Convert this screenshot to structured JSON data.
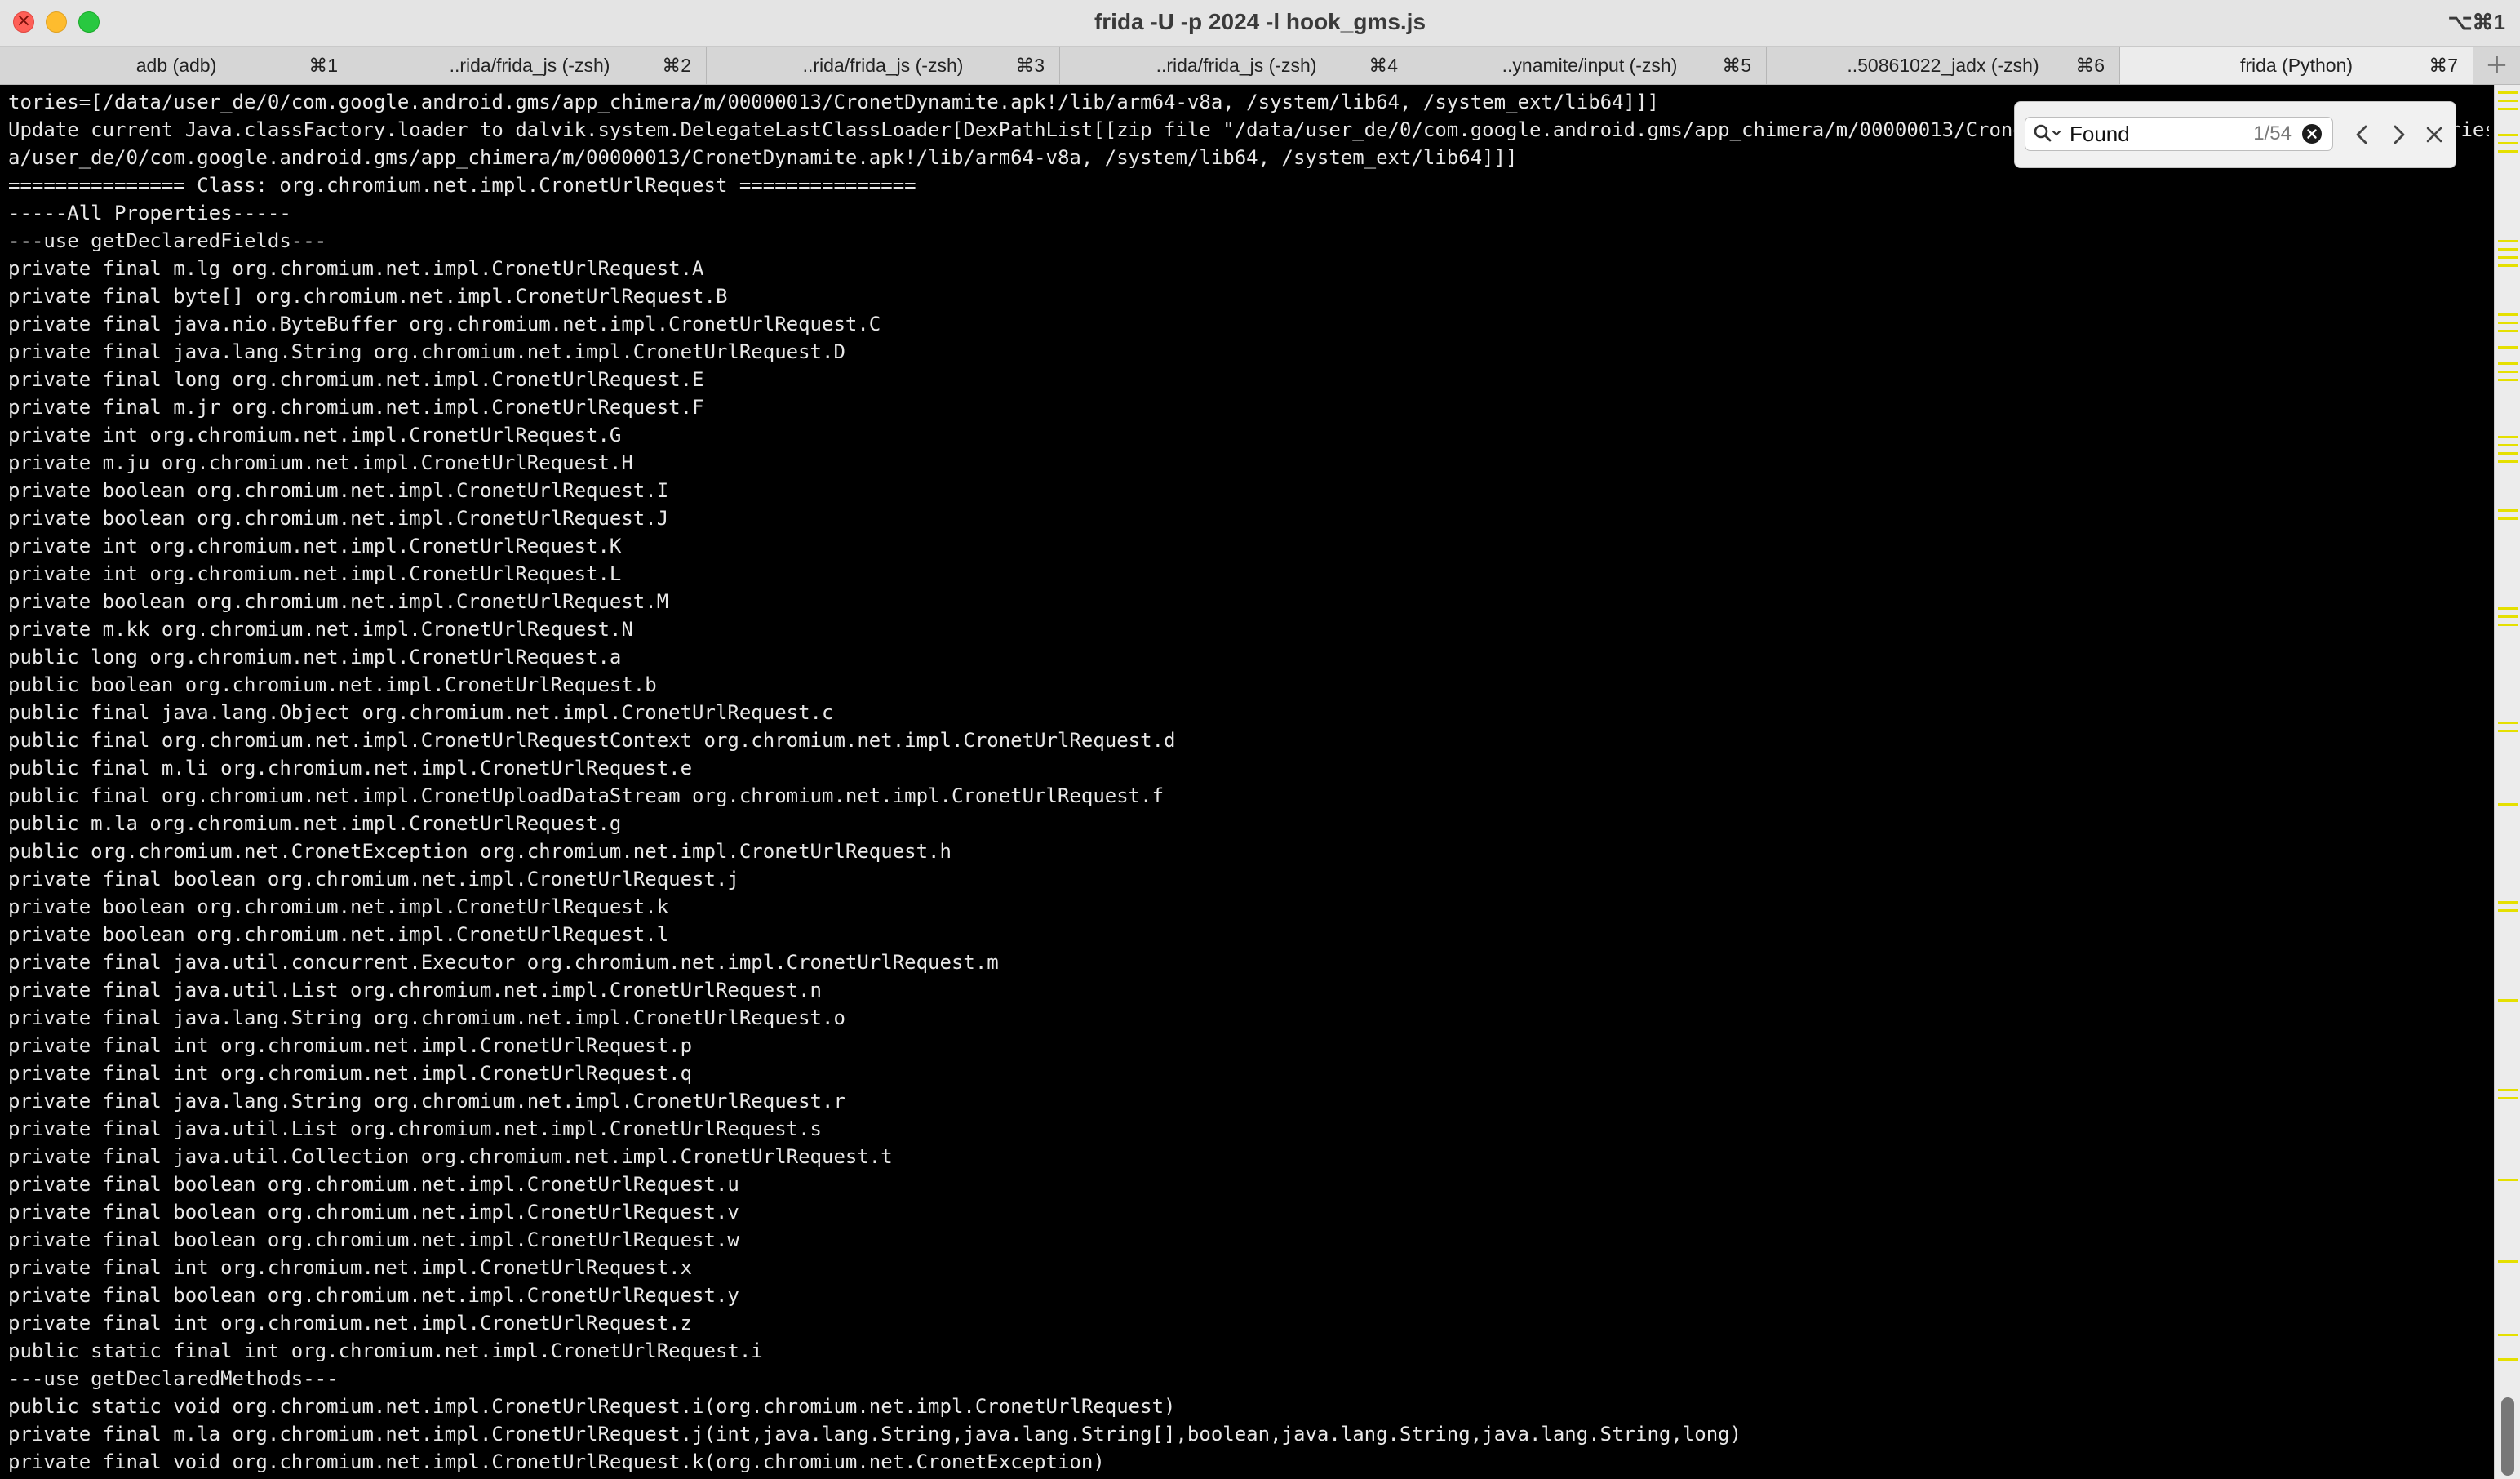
{
  "window": {
    "title": "frida -U -p 2024 -l hook_gms.js",
    "shortcut": "⌥⌘1"
  },
  "tabs": [
    {
      "label": "adb (adb)",
      "shortcut": "⌘1",
      "active": false
    },
    {
      "label": "..rida/frida_js (-zsh)",
      "shortcut": "⌘2",
      "active": false
    },
    {
      "label": "..rida/frida_js (-zsh)",
      "shortcut": "⌘3",
      "active": false
    },
    {
      "label": "..rida/frida_js (-zsh)",
      "shortcut": "⌘4",
      "active": false
    },
    {
      "label": "..ynamite/input (-zsh)",
      "shortcut": "⌘5",
      "active": false
    },
    {
      "label": "..50861022_jadx (-zsh)",
      "shortcut": "⌘6",
      "active": false
    },
    {
      "label": "frida (Python)",
      "shortcut": "⌘7",
      "active": true
    }
  ],
  "tab_add_label": "+",
  "find": {
    "query": "Found",
    "count": "1/54"
  },
  "icons": {
    "close": "close-icon",
    "search": "search-icon",
    "clear": "clear-icon",
    "prev": "chevron-left-icon",
    "next": "chevron-right-icon",
    "dismiss": "close-icon"
  },
  "colors": {
    "terminal_bg": "#000000",
    "terminal_fg": "#e8e8e8",
    "match_marker": "#e5e000"
  },
  "terminal": {
    "lines": [
      "tories=[/data/user_de/0/com.google.android.gms/app_chimera/m/00000013/CronetDynamite.apk!/lib/arm64-v8a, /system/lib64, /system_ext/lib64]]]",
      "Update current Java.classFactory.loader to dalvik.system.DelegateLastClassLoader[DexPathList[[zip file \"/data/user_de/0/com.google.android.gms/app_chimera/m/00000013/CronetDynamite.apk\"],nativeLibraryDirectories=[/dat",
      "a/user_de/0/com.google.android.gms/app_chimera/m/00000013/CronetDynamite.apk!/lib/arm64-v8a, /system/lib64, /system_ext/lib64]]]",
      "=============== Class: org.chromium.net.impl.CronetUrlRequest ===============",
      "-----All Properties-----",
      "---use getDeclaredFields---",
      "private final m.lg org.chromium.net.impl.CronetUrlRequest.A",
      "private final byte[] org.chromium.net.impl.CronetUrlRequest.B",
      "private final java.nio.ByteBuffer org.chromium.net.impl.CronetUrlRequest.C",
      "private final java.lang.String org.chromium.net.impl.CronetUrlRequest.D",
      "private final long org.chromium.net.impl.CronetUrlRequest.E",
      "private final m.jr org.chromium.net.impl.CronetUrlRequest.F",
      "private int org.chromium.net.impl.CronetUrlRequest.G",
      "private m.ju org.chromium.net.impl.CronetUrlRequest.H",
      "private boolean org.chromium.net.impl.CronetUrlRequest.I",
      "private boolean org.chromium.net.impl.CronetUrlRequest.J",
      "private int org.chromium.net.impl.CronetUrlRequest.K",
      "private int org.chromium.net.impl.CronetUrlRequest.L",
      "private boolean org.chromium.net.impl.CronetUrlRequest.M",
      "private m.kk org.chromium.net.impl.CronetUrlRequest.N",
      "public long org.chromium.net.impl.CronetUrlRequest.a",
      "public boolean org.chromium.net.impl.CronetUrlRequest.b",
      "public final java.lang.Object org.chromium.net.impl.CronetUrlRequest.c",
      "public final org.chromium.net.impl.CronetUrlRequestContext org.chromium.net.impl.CronetUrlRequest.d",
      "public final m.li org.chromium.net.impl.CronetUrlRequest.e",
      "public final org.chromium.net.impl.CronetUploadDataStream org.chromium.net.impl.CronetUrlRequest.f",
      "public m.la org.chromium.net.impl.CronetUrlRequest.g",
      "public org.chromium.net.CronetException org.chromium.net.impl.CronetUrlRequest.h",
      "private final boolean org.chromium.net.impl.CronetUrlRequest.j",
      "private boolean org.chromium.net.impl.CronetUrlRequest.k",
      "private boolean org.chromium.net.impl.CronetUrlRequest.l",
      "private final java.util.concurrent.Executor org.chromium.net.impl.CronetUrlRequest.m",
      "private final java.util.List org.chromium.net.impl.CronetUrlRequest.n",
      "private final java.lang.String org.chromium.net.impl.CronetUrlRequest.o",
      "private final int org.chromium.net.impl.CronetUrlRequest.p",
      "private final int org.chromium.net.impl.CronetUrlRequest.q",
      "private final java.lang.String org.chromium.net.impl.CronetUrlRequest.r",
      "private final java.util.List org.chromium.net.impl.CronetUrlRequest.s",
      "private final java.util.Collection org.chromium.net.impl.CronetUrlRequest.t",
      "private final boolean org.chromium.net.impl.CronetUrlRequest.u",
      "private final boolean org.chromium.net.impl.CronetUrlRequest.v",
      "private final boolean org.chromium.net.impl.CronetUrlRequest.w",
      "private final int org.chromium.net.impl.CronetUrlRequest.x",
      "private final boolean org.chromium.net.impl.CronetUrlRequest.y",
      "private final int org.chromium.net.impl.CronetUrlRequest.z",
      "public static final int org.chromium.net.impl.CronetUrlRequest.i",
      "---use getDeclaredMethods---",
      "public static void org.chromium.net.impl.CronetUrlRequest.i(org.chromium.net.impl.CronetUrlRequest)",
      "private final m.la org.chromium.net.impl.CronetUrlRequest.j(int,java.lang.String,java.lang.String[],boolean,java.lang.String,java.lang.String,long)",
      "private final void org.chromium.net.impl.CronetUrlRequest.k(org.chromium.net.CronetException)"
    ]
  }
}
